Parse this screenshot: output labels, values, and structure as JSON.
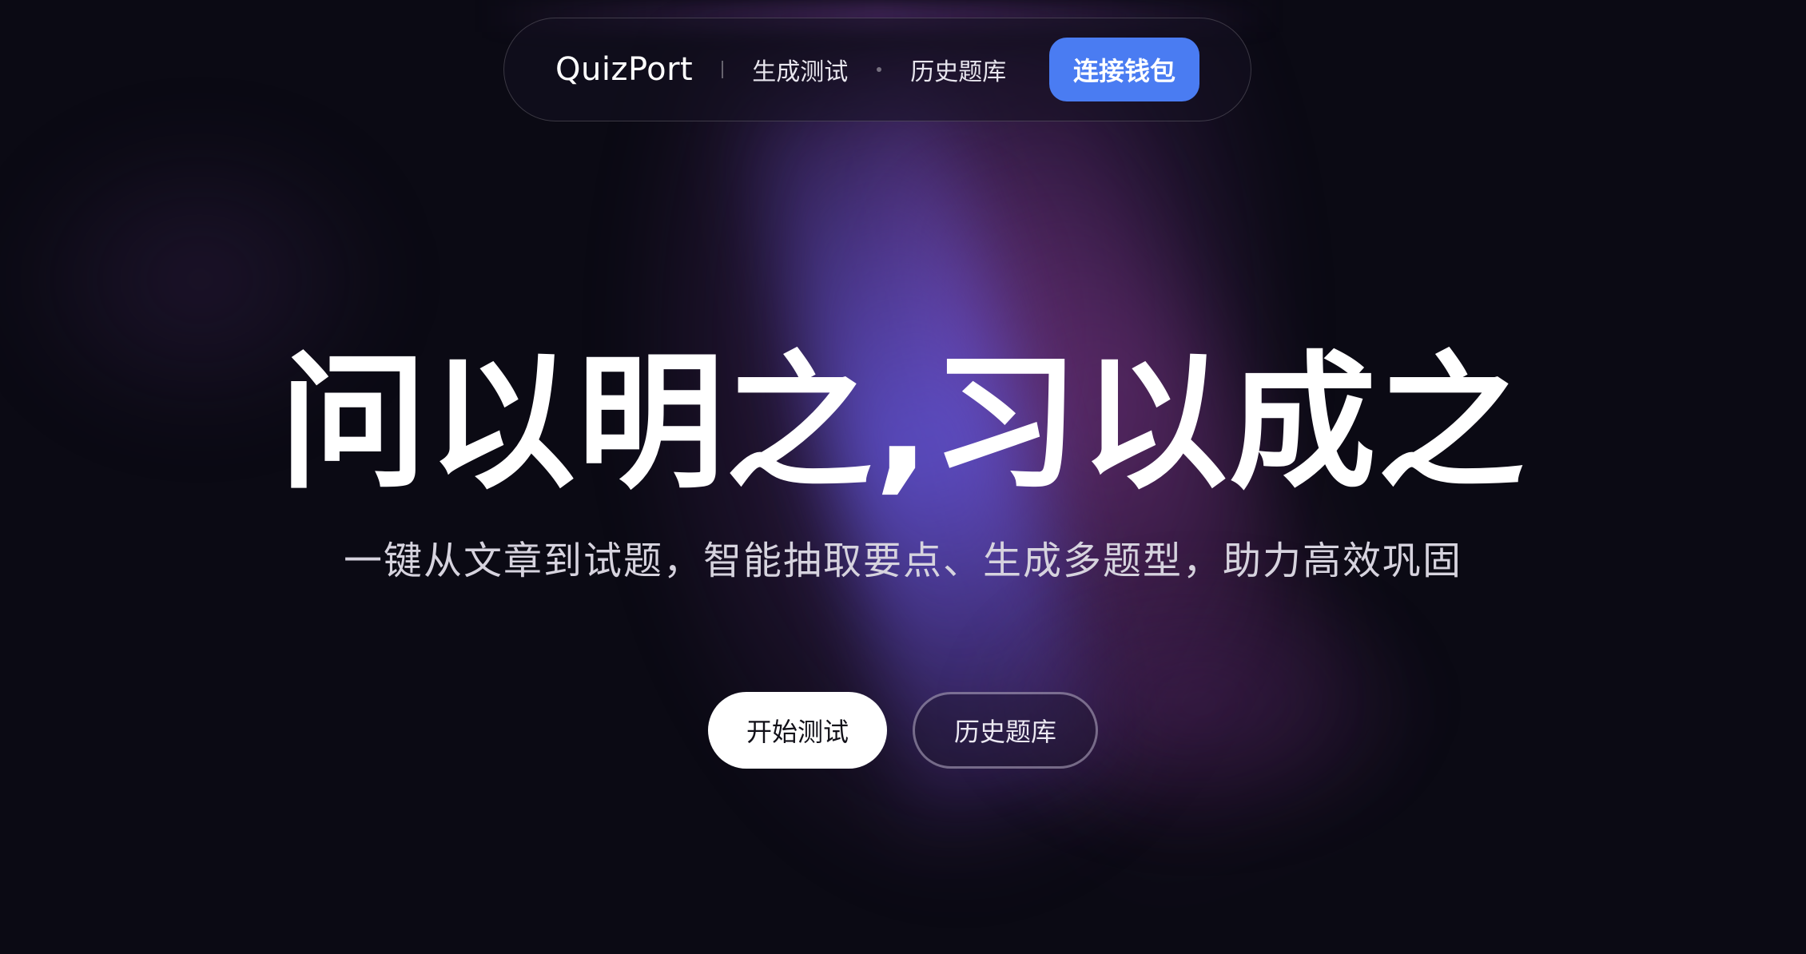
{
  "nav": {
    "brand": "QuizPort",
    "links": [
      "生成测试",
      "历史题库"
    ],
    "wallet_button": "连接钱包"
  },
  "hero": {
    "title": "问以明之,习以成之",
    "subtitle": "一键从文章到试题，智能抽取要点、生成多题型，助力高效巩固",
    "primary_button": "开始测试",
    "secondary_button": "历史题库"
  },
  "colors": {
    "background": "#0b0a14",
    "accent": "#4a7cf2",
    "text": "#ffffff"
  }
}
